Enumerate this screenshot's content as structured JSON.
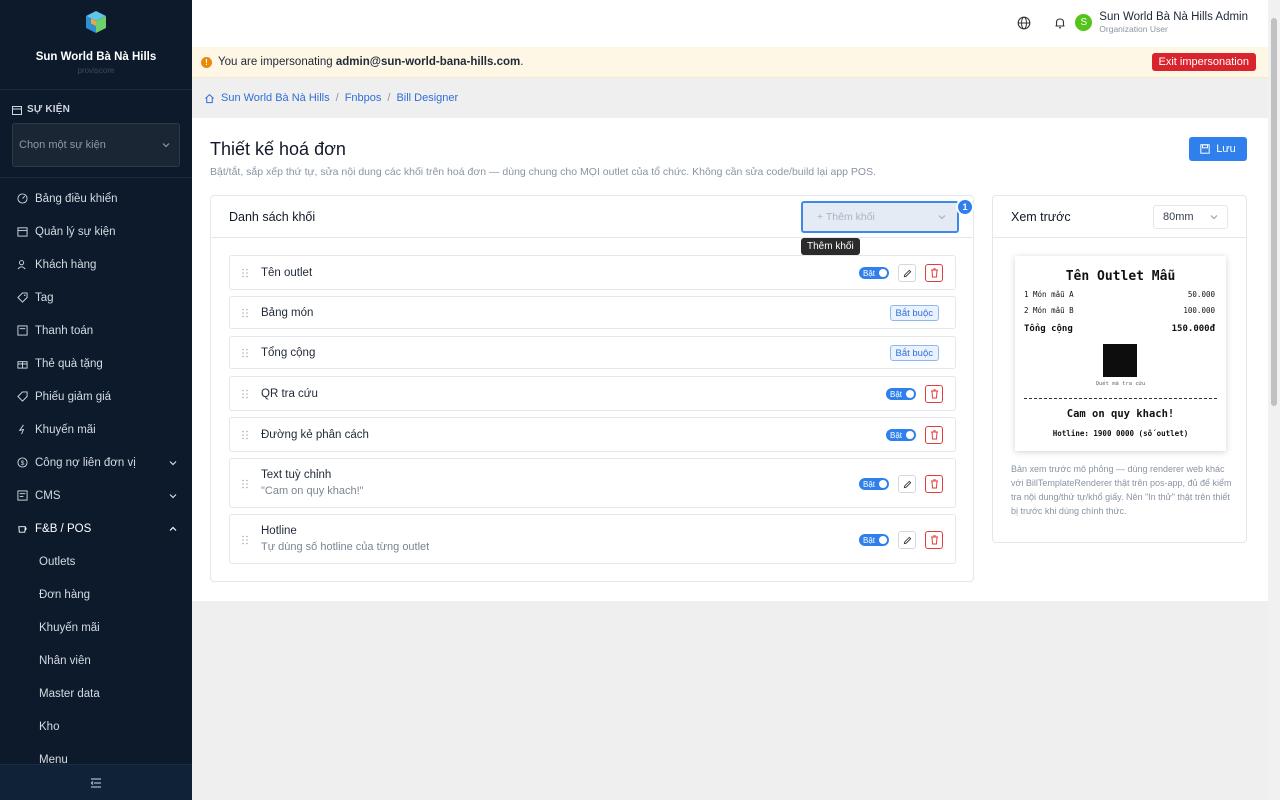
{
  "sidebar": {
    "org_name": "Sun World Bà Nà Hills",
    "org_sub": "proviscore",
    "section_label": "SỰ KIỆN",
    "event_select_placeholder": "Chọn một sự kiện",
    "items": [
      {
        "label": "Bảng điều khiển",
        "icon": "dashboard-icon"
      },
      {
        "label": "Quản lý sự kiện",
        "icon": "calendar-icon"
      },
      {
        "label": "Khách hàng",
        "icon": "users-icon"
      },
      {
        "label": "Tag",
        "icon": "tag-icon"
      },
      {
        "label": "Thanh toán",
        "icon": "payment-icon"
      },
      {
        "label": "Thẻ quà tặng",
        "icon": "gift-icon"
      },
      {
        "label": "Phiếu giảm giá",
        "icon": "coupon-icon"
      },
      {
        "label": "Khuyến mãi",
        "icon": "flash-icon"
      },
      {
        "label": "Công nợ liên đơn vị",
        "icon": "wallet-icon"
      },
      {
        "label": "CMS",
        "icon": "cms-icon"
      },
      {
        "label": "F&B / POS",
        "icon": "coffee-icon"
      }
    ],
    "sub_items": [
      "Outlets",
      "Đơn hàng",
      "Khuyến mãi",
      "Nhân viên",
      "Master data",
      "Kho",
      "Menu"
    ]
  },
  "topbar": {
    "user_initial": "S",
    "user_name": "Sun World Bà Nà Hills Admin",
    "user_role": "Organization User"
  },
  "banner": {
    "prefix": "You are impersonating",
    "email": "admin@sun-world-bana-hills.com",
    "suffix": ".",
    "exit_label": "Exit impersonation"
  },
  "breadcrumb": [
    "Sun World Bà Nà Hills",
    "Fnbpos",
    "Bill Designer"
  ],
  "page": {
    "title": "Thiết kế hoá đơn",
    "description": "Bật/tắt, sắp xếp thứ tự, sửa nội dung các khối trên hoá đơn — dùng chung cho MỌI outlet của tổ chức. Không cần sửa code/build lại app POS.",
    "save_label": "Lưu"
  },
  "blocks": {
    "header": "Danh sách khối",
    "add_placeholder": "+ Thêm khối",
    "badge": "1",
    "tooltip": "Thêm khối",
    "toggle_on": "Bật",
    "required_label": "Bắt buộc",
    "rows": [
      {
        "label": "Tên outlet",
        "sub": ""
      },
      {
        "label": "Bảng món",
        "sub": ""
      },
      {
        "label": "Tổng cộng",
        "sub": ""
      },
      {
        "label": "QR tra cứu",
        "sub": ""
      },
      {
        "label": "Đường kẻ phân cách",
        "sub": ""
      },
      {
        "label": "Text tuỳ chỉnh",
        "sub": "\"Cam on quy khach!\""
      },
      {
        "label": "Hotline",
        "sub": "Tự dùng số hotline của từng outlet"
      }
    ]
  },
  "preview": {
    "header": "Xem trước",
    "size": "80mm",
    "receipt": {
      "title": "Tên Outlet Mẫu",
      "line1_name": "1 Món mẫu A",
      "line1_price": "50.000",
      "line2_name": "2 Món mẫu B",
      "line2_price": "100.000",
      "total_label": "Tổng cộng",
      "total_value": "150.000đ",
      "qr_caption": "Quét mã tra cứu",
      "thanks": "Cam on quy khach!",
      "hotline": "Hotline: 1900 0000 (số outlet)"
    },
    "note": "Bản xem trước mô phỏng — dùng renderer web khác với BillTemplateRenderer thật trên pos-app, đủ để kiểm tra nội dung/thứ tự/khổ giấy. Nên \"In thử\" thật trên thiết bị trước khi dùng chính thức."
  }
}
